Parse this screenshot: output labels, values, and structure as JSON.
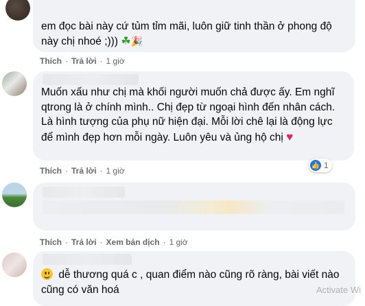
{
  "comments": [
    {
      "text": "em đọc bài này cứ tủm tỉm mãi, luôn giữ tinh thần ở phong độ này chị nhoé ;)))",
      "emojis": [
        "clover",
        "party-popper"
      ],
      "actions": {
        "like": "Thích",
        "reply": "Trả lời",
        "time": "1 giờ"
      }
    },
    {
      "text": "Muốn xấu như chị mà khối người muốn chả được ấy. Em nghĩ qtrong là ở chính mình.. Chị đẹp từ ngoại hình đến nhân cách. Là hình tượng của phụ nữ hiện đại. Mỗi lời chê lại là động lực để mình đẹp hơn mỗi ngày. Luôn yêu và ủng hộ chị",
      "emojis": [
        "red-heart"
      ],
      "reaction_count": "1",
      "actions": {
        "like": "Thích",
        "reply": "Trả lời",
        "time": "1 giờ"
      }
    },
    {
      "text": "",
      "actions": {
        "like": "Thích",
        "reply": "Trả lời",
        "translate": "Xem bản dịch",
        "time": "1 giờ"
      }
    },
    {
      "text": "dễ thương quá c , quan điểm nào cũng rõ ràng, bài viết nào cũng có văn hoá",
      "emojis": [
        "slightly-smiling-face"
      ]
    }
  ],
  "watermark": "Activate Wi",
  "colors": {
    "bubble": "#f0f2f5",
    "meta": "#65676b",
    "like_blue": "#1877f2",
    "heart": "#e0245e"
  }
}
